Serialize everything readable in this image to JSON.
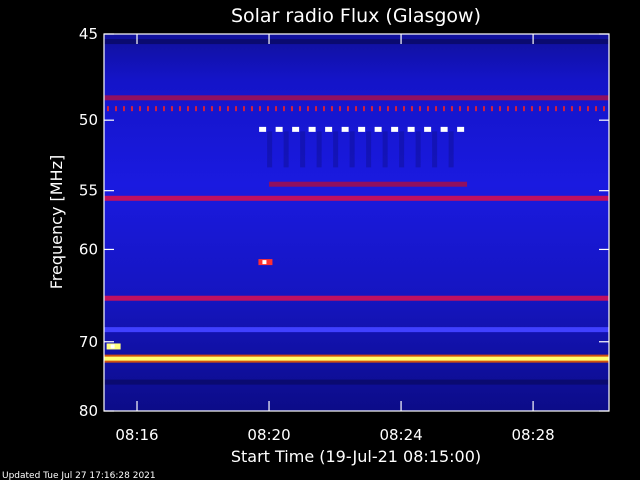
{
  "chart_data": {
    "type": "heatmap",
    "title": "Solar radio Flux (Glasgow)",
    "ylabel": "Frequency [MHz]",
    "xlabel": "Start Time (19-Jul-21 08:15:00)",
    "ylim": [
      45,
      80
    ],
    "xlim_minutes_after_start": [
      0,
      15.3
    ],
    "y_ticks": [
      {
        "value": 45,
        "label": "45"
      },
      {
        "value": 50,
        "label": "50"
      },
      {
        "value": 55,
        "label": "55"
      },
      {
        "value": 60,
        "label": "60"
      },
      {
        "value": 70,
        "label": "70"
      },
      {
        "value": 80,
        "label": "80"
      }
    ],
    "x_ticks": [
      {
        "value": 1,
        "label": "08:16"
      },
      {
        "value": 5,
        "label": "08:20"
      },
      {
        "value": 9,
        "label": "08:24"
      },
      {
        "value": 13,
        "label": "08:28"
      }
    ],
    "background_color": "#1a1ad0",
    "features": [
      {
        "kind": "band",
        "freq": 45.4,
        "intensity": 0.2
      },
      {
        "kind": "band",
        "freq": 48.6,
        "intensity": 0.55
      },
      {
        "kind": "dotted_band",
        "freq": 49.3,
        "intensity": 0.6,
        "start": 0,
        "end": 15.3
      },
      {
        "kind": "burst_dots",
        "freq": 50.6,
        "start": 4.7,
        "end": 10.9,
        "intensity": 1.0
      },
      {
        "kind": "band",
        "freq": 54.5,
        "intensity": 0.55,
        "start": 5.0,
        "end": 11.0
      },
      {
        "kind": "band",
        "freq": 55.6,
        "intensity": 0.7
      },
      {
        "kind": "spot",
        "freq": 61.2,
        "time": 4.8,
        "intensity": 0.85
      },
      {
        "kind": "band",
        "freq": 64.9,
        "intensity": 0.7
      },
      {
        "kind": "band",
        "freq": 68.5,
        "intensity": 0.35
      },
      {
        "kind": "spot",
        "freq": 70.6,
        "time": 0.2,
        "intensity": 1.0
      },
      {
        "kind": "band",
        "freq": 72.2,
        "intensity": 1.0
      },
      {
        "kind": "band",
        "freq": 75.5,
        "intensity": 0.2
      }
    ]
  },
  "footer": "Updated Tue Jul 27 17:16:28 2021"
}
